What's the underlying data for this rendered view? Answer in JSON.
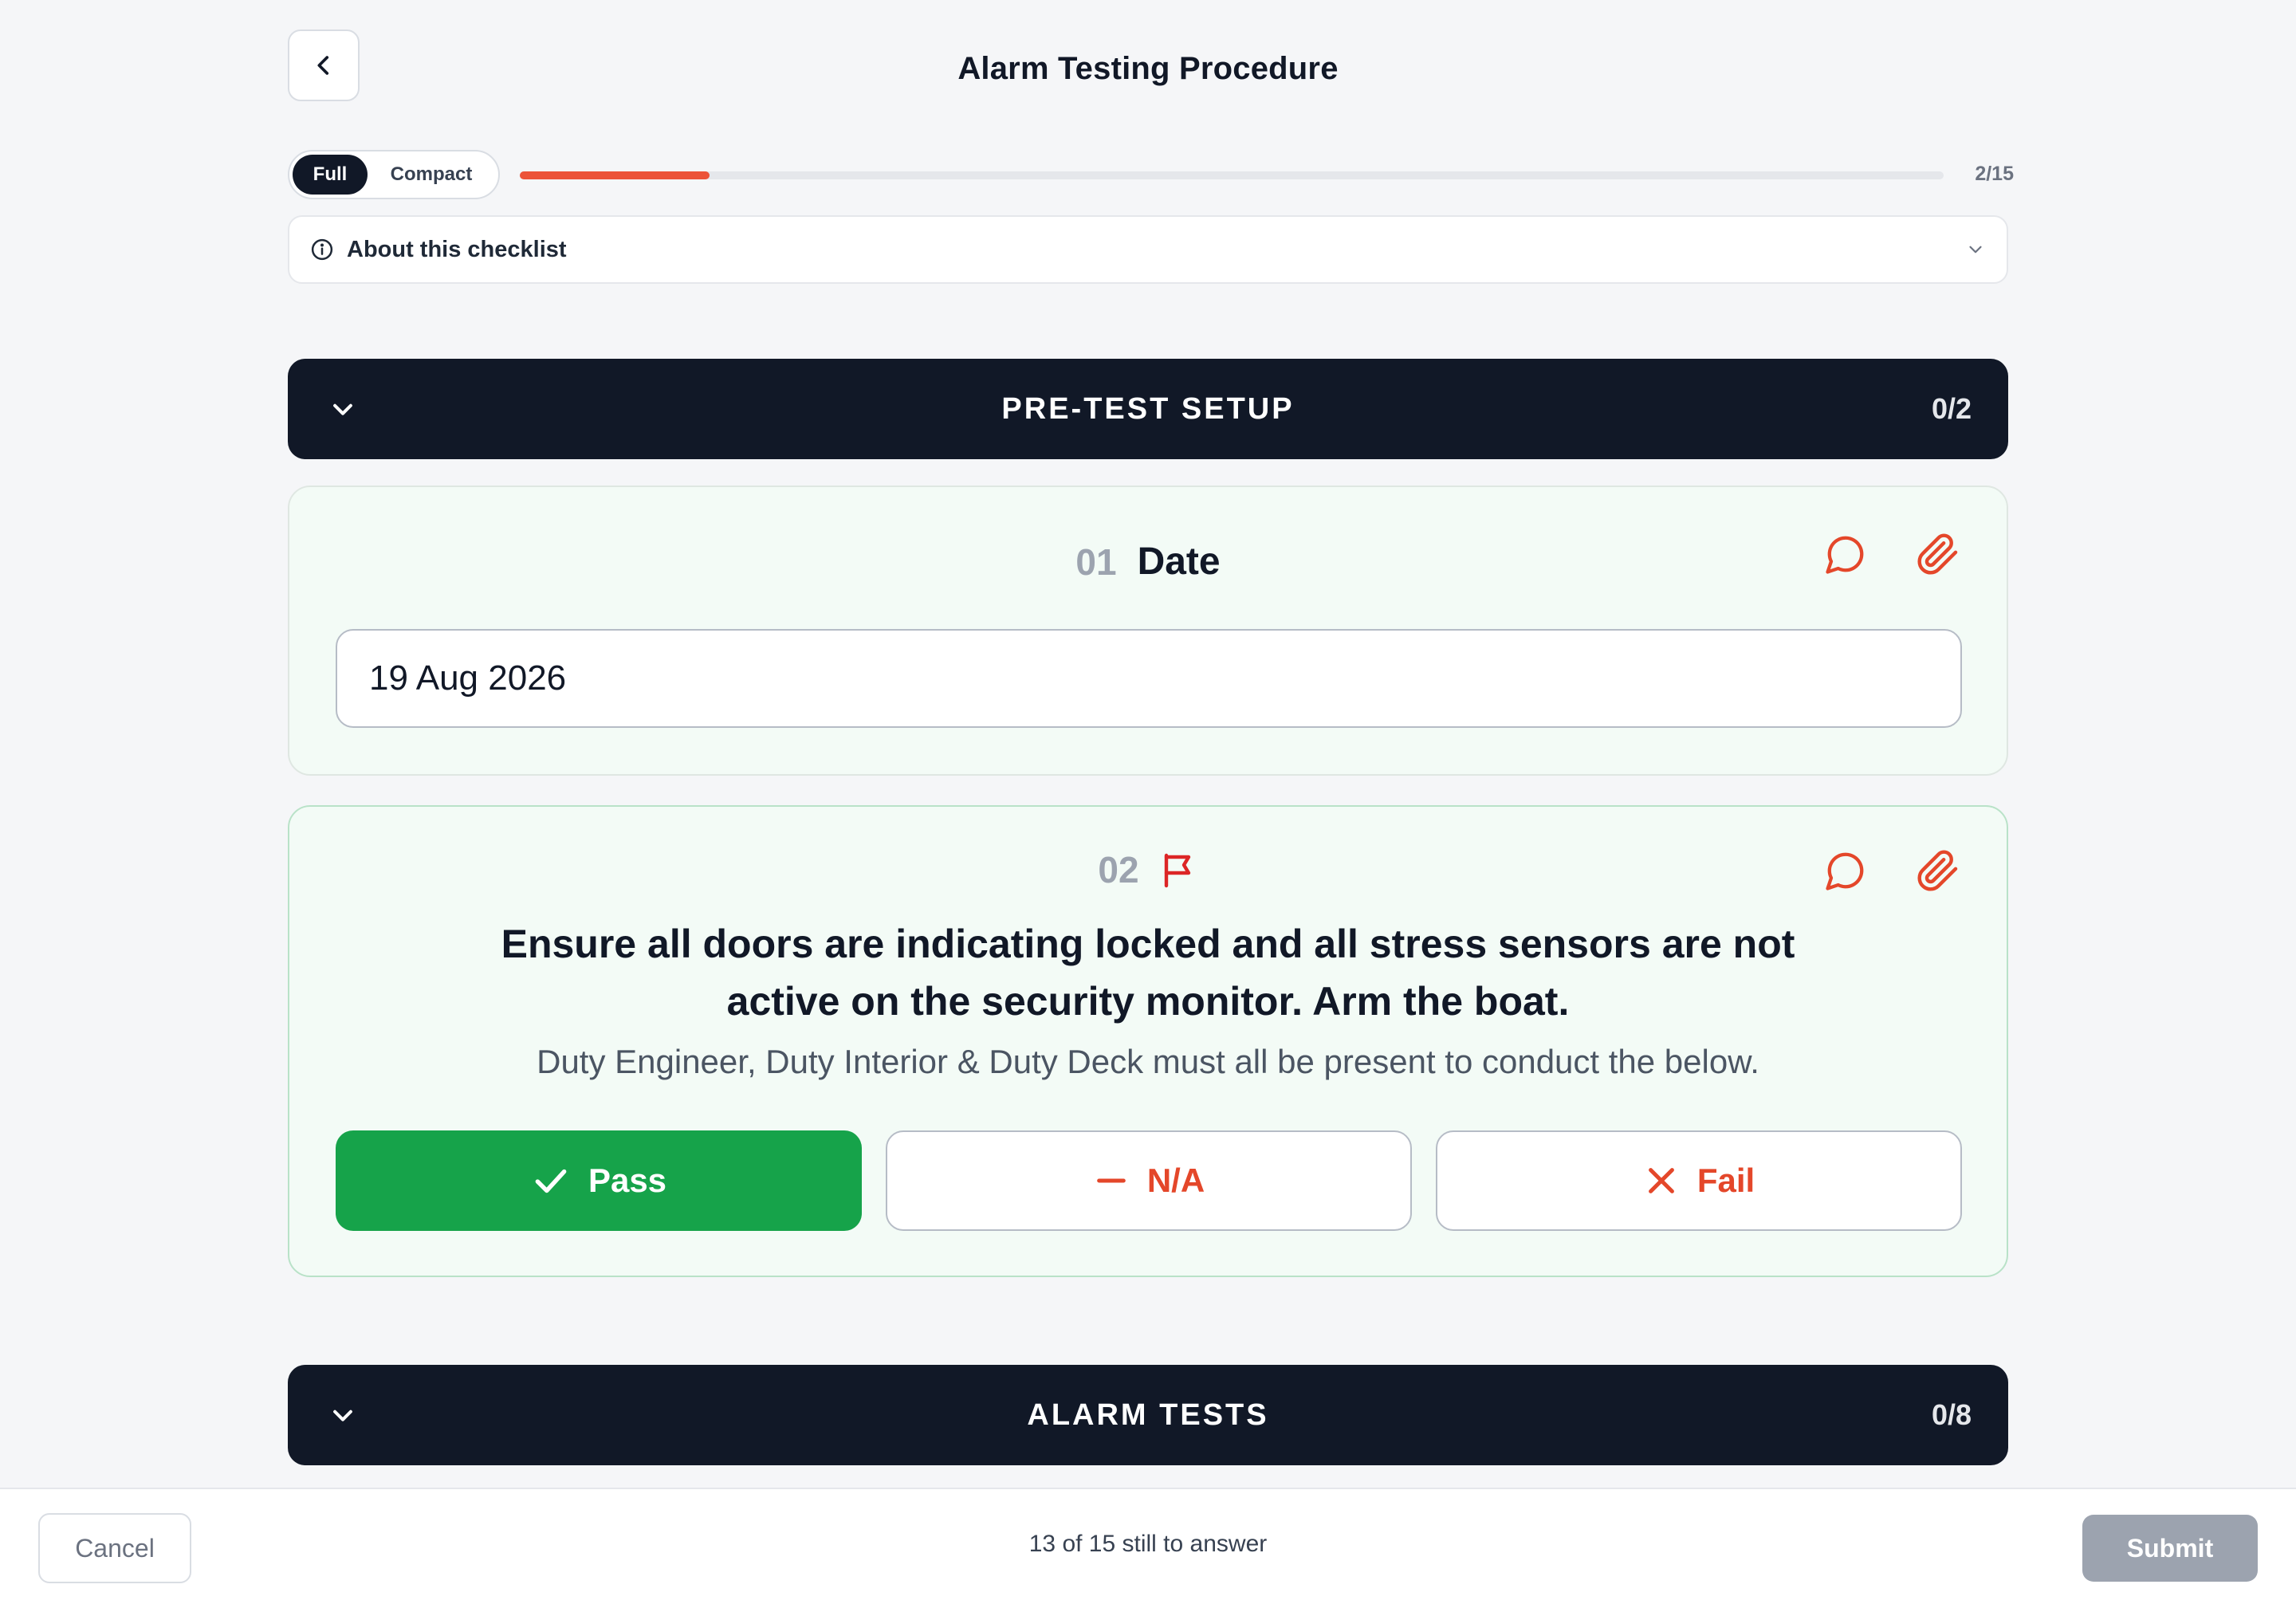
{
  "header": {
    "title": "Alarm Testing Procedure",
    "back_icon": "chevron-left-icon"
  },
  "view_mode": {
    "options": [
      "Full",
      "Compact"
    ],
    "selected": "Full"
  },
  "progress": {
    "label": "2/15",
    "answered": 2,
    "total": 15,
    "fraction": 0.1333,
    "color": "#ec5338"
  },
  "about": {
    "label": "About this checklist",
    "icon": "info-icon",
    "chevron": "chevron-down-icon"
  },
  "sections": [
    {
      "title": "PRE-TEST SETUP",
      "count": "0/2",
      "questions": [
        {
          "number": "01",
          "title": "Date",
          "type": "date",
          "value": "19 Aug 2026"
        },
        {
          "number": "02",
          "flagged": true,
          "text": "Ensure all doors are indicating locked and all stress sensors are not active on the security monitor. Arm the boat.",
          "subtext": "Duty Engineer, Duty Interior & Duty Deck must all be present to conduct the below.",
          "answers": [
            "Pass",
            "N/A",
            "Fail"
          ],
          "selected": "Pass"
        }
      ]
    },
    {
      "title": "ALARM TESTS",
      "count": "0/8"
    }
  ],
  "footer": {
    "cancel_label": "Cancel",
    "remaining": "13 of 15 still to answer",
    "submit_label": "Submit"
  },
  "colors": {
    "accent": "#e4472a",
    "pass": "#16a34a",
    "dark": "#111827"
  }
}
